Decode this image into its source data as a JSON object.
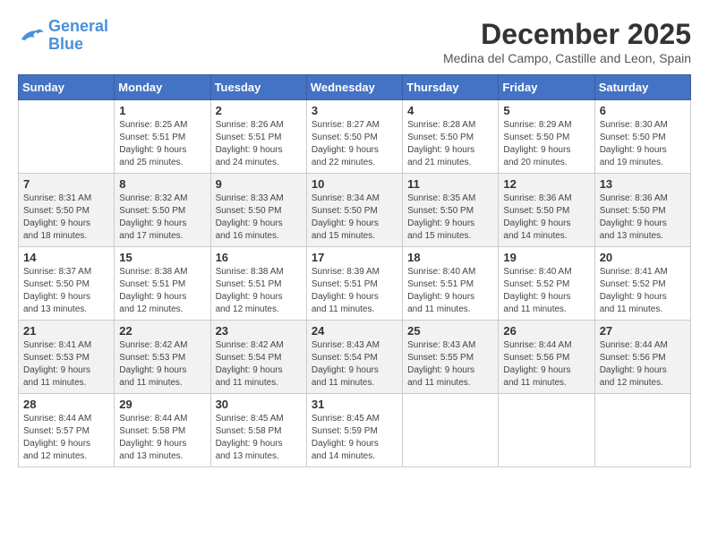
{
  "logo": {
    "line1": "General",
    "line2": "Blue"
  },
  "title": "December 2025",
  "location": "Medina del Campo, Castille and Leon, Spain",
  "days_of_week": [
    "Sunday",
    "Monday",
    "Tuesday",
    "Wednesday",
    "Thursday",
    "Friday",
    "Saturday"
  ],
  "weeks": [
    [
      {
        "day": "",
        "info": ""
      },
      {
        "day": "1",
        "info": "Sunrise: 8:25 AM\nSunset: 5:51 PM\nDaylight: 9 hours\nand 25 minutes."
      },
      {
        "day": "2",
        "info": "Sunrise: 8:26 AM\nSunset: 5:51 PM\nDaylight: 9 hours\nand 24 minutes."
      },
      {
        "day": "3",
        "info": "Sunrise: 8:27 AM\nSunset: 5:50 PM\nDaylight: 9 hours\nand 22 minutes."
      },
      {
        "day": "4",
        "info": "Sunrise: 8:28 AM\nSunset: 5:50 PM\nDaylight: 9 hours\nand 21 minutes."
      },
      {
        "day": "5",
        "info": "Sunrise: 8:29 AM\nSunset: 5:50 PM\nDaylight: 9 hours\nand 20 minutes."
      },
      {
        "day": "6",
        "info": "Sunrise: 8:30 AM\nSunset: 5:50 PM\nDaylight: 9 hours\nand 19 minutes."
      }
    ],
    [
      {
        "day": "7",
        "info": "Sunrise: 8:31 AM\nSunset: 5:50 PM\nDaylight: 9 hours\nand 18 minutes."
      },
      {
        "day": "8",
        "info": "Sunrise: 8:32 AM\nSunset: 5:50 PM\nDaylight: 9 hours\nand 17 minutes."
      },
      {
        "day": "9",
        "info": "Sunrise: 8:33 AM\nSunset: 5:50 PM\nDaylight: 9 hours\nand 16 minutes."
      },
      {
        "day": "10",
        "info": "Sunrise: 8:34 AM\nSunset: 5:50 PM\nDaylight: 9 hours\nand 15 minutes."
      },
      {
        "day": "11",
        "info": "Sunrise: 8:35 AM\nSunset: 5:50 PM\nDaylight: 9 hours\nand 15 minutes."
      },
      {
        "day": "12",
        "info": "Sunrise: 8:36 AM\nSunset: 5:50 PM\nDaylight: 9 hours\nand 14 minutes."
      },
      {
        "day": "13",
        "info": "Sunrise: 8:36 AM\nSunset: 5:50 PM\nDaylight: 9 hours\nand 13 minutes."
      }
    ],
    [
      {
        "day": "14",
        "info": "Sunrise: 8:37 AM\nSunset: 5:50 PM\nDaylight: 9 hours\nand 13 minutes."
      },
      {
        "day": "15",
        "info": "Sunrise: 8:38 AM\nSunset: 5:51 PM\nDaylight: 9 hours\nand 12 minutes."
      },
      {
        "day": "16",
        "info": "Sunrise: 8:38 AM\nSunset: 5:51 PM\nDaylight: 9 hours\nand 12 minutes."
      },
      {
        "day": "17",
        "info": "Sunrise: 8:39 AM\nSunset: 5:51 PM\nDaylight: 9 hours\nand 11 minutes."
      },
      {
        "day": "18",
        "info": "Sunrise: 8:40 AM\nSunset: 5:51 PM\nDaylight: 9 hours\nand 11 minutes."
      },
      {
        "day": "19",
        "info": "Sunrise: 8:40 AM\nSunset: 5:52 PM\nDaylight: 9 hours\nand 11 minutes."
      },
      {
        "day": "20",
        "info": "Sunrise: 8:41 AM\nSunset: 5:52 PM\nDaylight: 9 hours\nand 11 minutes."
      }
    ],
    [
      {
        "day": "21",
        "info": "Sunrise: 8:41 AM\nSunset: 5:53 PM\nDaylight: 9 hours\nand 11 minutes."
      },
      {
        "day": "22",
        "info": "Sunrise: 8:42 AM\nSunset: 5:53 PM\nDaylight: 9 hours\nand 11 minutes."
      },
      {
        "day": "23",
        "info": "Sunrise: 8:42 AM\nSunset: 5:54 PM\nDaylight: 9 hours\nand 11 minutes."
      },
      {
        "day": "24",
        "info": "Sunrise: 8:43 AM\nSunset: 5:54 PM\nDaylight: 9 hours\nand 11 minutes."
      },
      {
        "day": "25",
        "info": "Sunrise: 8:43 AM\nSunset: 5:55 PM\nDaylight: 9 hours\nand 11 minutes."
      },
      {
        "day": "26",
        "info": "Sunrise: 8:44 AM\nSunset: 5:56 PM\nDaylight: 9 hours\nand 11 minutes."
      },
      {
        "day": "27",
        "info": "Sunrise: 8:44 AM\nSunset: 5:56 PM\nDaylight: 9 hours\nand 12 minutes."
      }
    ],
    [
      {
        "day": "28",
        "info": "Sunrise: 8:44 AM\nSunset: 5:57 PM\nDaylight: 9 hours\nand 12 minutes."
      },
      {
        "day": "29",
        "info": "Sunrise: 8:44 AM\nSunset: 5:58 PM\nDaylight: 9 hours\nand 13 minutes."
      },
      {
        "day": "30",
        "info": "Sunrise: 8:45 AM\nSunset: 5:58 PM\nDaylight: 9 hours\nand 13 minutes."
      },
      {
        "day": "31",
        "info": "Sunrise: 8:45 AM\nSunset: 5:59 PM\nDaylight: 9 hours\nand 14 minutes."
      },
      {
        "day": "",
        "info": ""
      },
      {
        "day": "",
        "info": ""
      },
      {
        "day": "",
        "info": ""
      }
    ]
  ]
}
